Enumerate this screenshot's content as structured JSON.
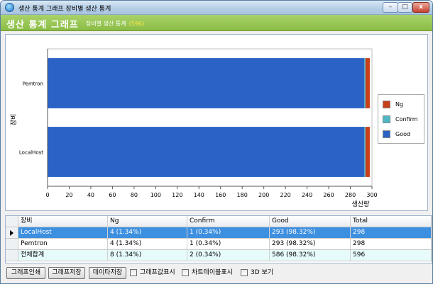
{
  "window": {
    "title": "생산 통계 그래프 장비별 생산 통계",
    "minimize_glyph": "–",
    "maximize_glyph": "□",
    "close_glyph": "x"
  },
  "header": {
    "title": "생산 통계 그래프",
    "subtitle": "장비별 생산 통계",
    "count": "(596)"
  },
  "colors": {
    "ng": "#c8401a",
    "confirm": "#4bb8c4",
    "good": "#2a62c6",
    "header_band": "#97c354",
    "selected_row": "#3d8fe0"
  },
  "chart_data": {
    "type": "bar",
    "orientation": "horizontal",
    "stacked": true,
    "categories": [
      "Pemtron",
      "LocalHost"
    ],
    "series": [
      {
        "name": "Good",
        "values": [
          293,
          293
        ]
      },
      {
        "name": "Confirm",
        "values": [
          1,
          1
        ]
      },
      {
        "name": "Ng",
        "values": [
          4,
          4
        ]
      }
    ],
    "xlabel": "생산량",
    "ylabel": "장비",
    "xlim": [
      0,
      300
    ],
    "xticks": [
      "0",
      "20",
      "40",
      "60",
      "80",
      "100",
      "120",
      "140",
      "160",
      "180",
      "200",
      "220",
      "240",
      "260",
      "280",
      "300"
    ],
    "grid": false,
    "legend_position": "right",
    "legend_order": [
      "Ng",
      "Confirm",
      "Good"
    ]
  },
  "table": {
    "columns": [
      "장비",
      "Ng",
      "Confirm",
      "Good",
      "Total"
    ],
    "rows": [
      {
        "device": "LocalHost",
        "ng": "4 (1.34%)",
        "confirm": "1 (0.34%)",
        "good": "293 (98.32%)",
        "total": "298"
      },
      {
        "device": "Pemtron",
        "ng": "4 (1.34%)",
        "confirm": "1 (0.34%)",
        "good": "293 (98.32%)",
        "total": "298"
      },
      {
        "device": "전체합계",
        "ng": "8 (1.34%)",
        "confirm": "2 (0.34%)",
        "good": "586 (98.32%)",
        "total": "596"
      }
    ]
  },
  "toolbar": {
    "print_button": "그래프인쇄",
    "save_graph_button": "그래프저장",
    "save_data_button": "데이타저장",
    "show_values_checkbox": "그래프값표시",
    "show_table_checkbox": "차트테이블표시",
    "view_3d_checkbox": "3D 보기"
  }
}
